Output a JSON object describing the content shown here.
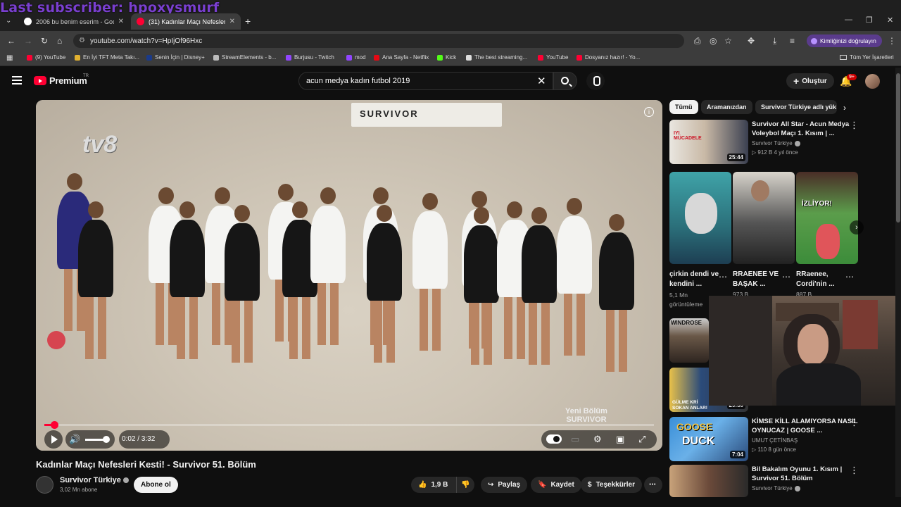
{
  "overlay": {
    "text": "Last subscriber: hpoxysmurf"
  },
  "browser": {
    "tabs": [
      {
        "label": "2006 bu benim eserim - Googl",
        "active": false
      },
      {
        "label": "(31) Kadınlar Maçı Nefesleri Ke",
        "active": true
      }
    ],
    "new_tab": "+",
    "url": "youtube.com/watch?v=HpIjOf96Hxc",
    "verify_label": "Kimliğinizi doğrulayın",
    "bookmarks": [
      {
        "label": "(9) YouTube",
        "color": "#ff0033"
      },
      {
        "label": "En İyi TFT Meta Takı...",
        "color": "#e0b030"
      },
      {
        "label": "Senin İçin | Disney+",
        "color": "#1a3a8a"
      },
      {
        "label": "StreamElements - b...",
        "color": "#bbbbbb"
      },
      {
        "label": "Burjusu - Twitch",
        "color": "#9146ff"
      },
      {
        "label": "mod",
        "color": "#9146ff"
      },
      {
        "label": "Ana Sayfa - Netflix",
        "color": "#e50914"
      },
      {
        "label": "Kick",
        "color": "#53fc18"
      },
      {
        "label": "The best streaming...",
        "color": "#dddddd"
      },
      {
        "label": "YouTube",
        "color": "#ff0033"
      },
      {
        "label": "Dosyanız hazır! - Yo...",
        "color": "#ff0033"
      }
    ],
    "all_bookmarks": "Tüm Yer İşaretleri"
  },
  "youtube": {
    "logo_text": "Premium",
    "logo_region": "TR",
    "search_query": "acun medya kadın futbol 2019",
    "create_label": "Oluştur",
    "notif_count": "9+"
  },
  "video": {
    "title": "Kadınlar Maçı Nefesleri Kesti! - Survivor 51. Bölüm",
    "time": "0:02 / 3:32",
    "progress": 0.01,
    "volume": 0.8,
    "channel_logo": "tv8",
    "watermark": "Yeni Bölüm\nSURVIVOR",
    "banner_text": "SURVIVOR",
    "channel": "Survivor Türkiye",
    "subs": "3,02 Mn abone",
    "subscribe_label": "Abone ol",
    "likes": "1,9 B",
    "share_label": "Paylaş",
    "save_label": "Kaydet",
    "thanks_label": "Teşekkürler"
  },
  "chips": [
    {
      "label": "Tümü",
      "selected": true
    },
    {
      "label": "Aramanızdan",
      "selected": false
    },
    {
      "label": "Survivor Türkiye adlı yük",
      "selected": false
    }
  ],
  "recommendations": [
    {
      "title": "Survivor All Star - Acun Medya Voleybol Maçı 1. Kısım | ...",
      "channel": "Survivor Türkiye",
      "meta": "912 B   4 yıl önce",
      "duration": "25:44"
    },
    {
      "title": "KİMSE KİLL ALAMIYORSA NASIL OYNUCAZ | GOOSE ...",
      "channel": "UMUT ÇETİNBAŞ",
      "meta": "110   8 gün önce",
      "duration": "7:04"
    },
    {
      "title": "Bil Bakalım Oyunu 1. Kısım | Survivor 51. Bölüm",
      "channel": "Survivor Türkiye",
      "meta": "",
      "duration": ""
    }
  ],
  "partial_rec": {
    "duration": "29:50"
  },
  "shorts": [
    {
      "title": "çirkin dendi ve kendini ...",
      "meta": "5,1 Mn görüntüleme"
    },
    {
      "title": "RRAENEE VE BAŞAK ...",
      "meta": "973 B"
    },
    {
      "title": "RRaenee, Cordi'nin ...",
      "meta": "887 B"
    }
  ],
  "shorts_overlay": {
    "izliyor": "İZLİYOR!"
  },
  "thumb_texts": {
    "goose": "GOOSE",
    "duck": "DUCK",
    "windrose": "WINDROSE",
    "gulme": "GÜLME KRİ",
    "sokan": "SOKAN ANLAR!"
  }
}
